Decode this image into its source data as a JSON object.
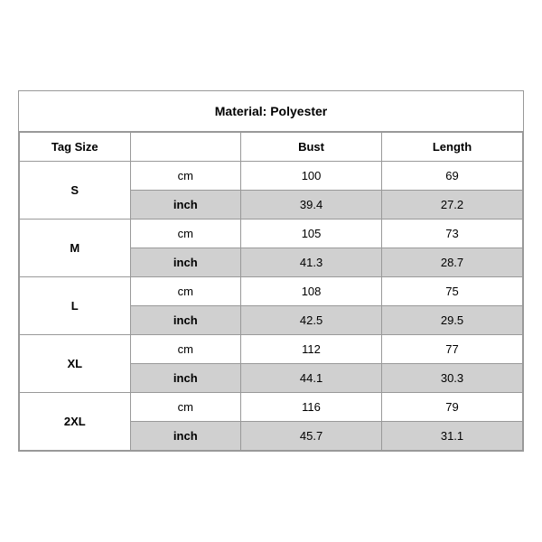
{
  "title": "Material: Polyester",
  "headers": {
    "tag_size": "Tag Size",
    "bust": "Bust",
    "length": "Length"
  },
  "rows": [
    {
      "size": "S",
      "cm_bust": "100",
      "cm_length": "69",
      "inch_bust": "39.4",
      "inch_length": "27.2"
    },
    {
      "size": "M",
      "cm_bust": "105",
      "cm_length": "73",
      "inch_bust": "41.3",
      "inch_length": "28.7"
    },
    {
      "size": "L",
      "cm_bust": "108",
      "cm_length": "75",
      "inch_bust": "42.5",
      "inch_length": "29.5"
    },
    {
      "size": "XL",
      "cm_bust": "112",
      "cm_length": "77",
      "inch_bust": "44.1",
      "inch_length": "30.3"
    },
    {
      "size": "2XL",
      "cm_bust": "116",
      "cm_length": "79",
      "inch_bust": "45.7",
      "inch_length": "31.1"
    }
  ],
  "units": {
    "cm": "cm",
    "inch": "inch"
  }
}
